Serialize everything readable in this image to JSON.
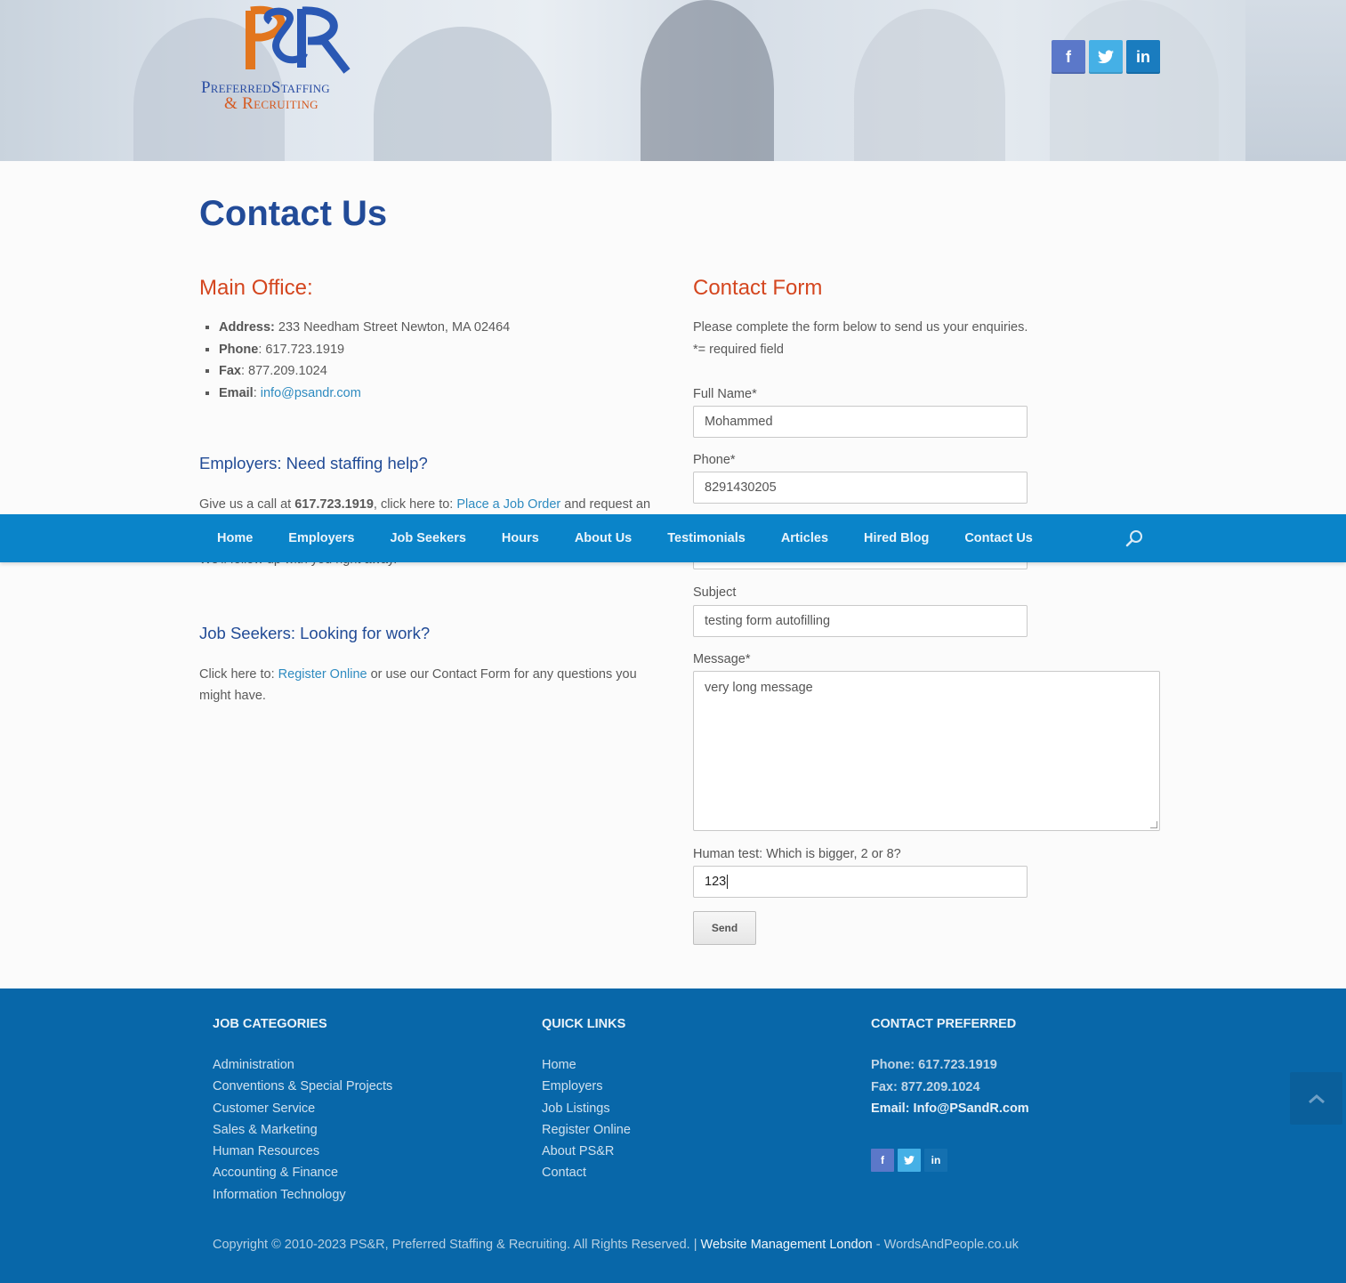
{
  "header": {
    "logo_line1": "PreferredStaffing",
    "logo_line2": "& Recruiting",
    "social": [
      {
        "name": "facebook",
        "glyph": "f",
        "color": "#5b78c9"
      },
      {
        "name": "twitter",
        "glyph": "t",
        "color": "#45b0e6"
      },
      {
        "name": "linkedin",
        "glyph": "in",
        "color": "#1a7cbf"
      }
    ]
  },
  "page": {
    "title": "Contact Us"
  },
  "main_office": {
    "heading": "Main Office:",
    "address_label": "Address:",
    "address_value": " 233 Needham Street Newton, MA 02464",
    "phone_label": "Phone",
    "phone_value": ":  617.723.1919",
    "fax_label": "Fax",
    "fax_value": ": 877.209.1024",
    "email_label": "Email",
    "email_sep": ": ",
    "email_value": "info@psandr.com"
  },
  "employers": {
    "heading": "Employers: Need staffing help?",
    "text_before": "Give us a call at ",
    "phone": "617.723.1919",
    "text_mid": ", click here to: ",
    "link": "Place a Job Order",
    "text_after": " and request an",
    "text_line2": "We'll follow up with you right away."
  },
  "job_seekers": {
    "heading": "Job Seekers: Looking for work?",
    "text_before": "Click here to: ",
    "link": "Register Online",
    "text_after": " or use our Contact Form for any questions you might have."
  },
  "contact_form": {
    "heading": "Contact Form",
    "intro": "Please complete the form below to send us your enquiries.",
    "required_note": "*= required field",
    "full_name_label": "Full Name*",
    "full_name_value": "Mohammed",
    "phone_label": "Phone*",
    "phone_value": "8291430205",
    "subject_label": "Subject",
    "subject_value": "testing form autofilling",
    "message_label": "Message*",
    "message_value": "very long message",
    "human_label": "Human test: Which is bigger, 2 or 8?",
    "human_value": "123",
    "send_label": "Send"
  },
  "nav": {
    "items": [
      "Home",
      "Employers",
      "Job Seekers",
      "Hours",
      "About Us",
      "Testimonials",
      "Articles",
      "Hired Blog",
      "Contact Us"
    ],
    "search_icon": "search-icon"
  },
  "footer": {
    "job_categories": {
      "heading": "JOB CATEGORIES",
      "items": [
        "Administration",
        "Conventions & Special Projects",
        "Customer Service",
        "Sales & Marketing",
        "Human Resources",
        "Accounting & Finance",
        "Information Technology"
      ]
    },
    "quick_links": {
      "heading": "QUICK LINKS",
      "items": [
        "Home",
        "Employers",
        "Job Listings",
        "Register Online",
        "About PS&R",
        "Contact"
      ]
    },
    "contact": {
      "heading": "CONTACT PREFERRED",
      "phone_label": "Phone:",
      "phone_value": " 617.723.1919",
      "fax_label": "Fax:",
      "fax_value": " 877.209.1024",
      "email_label": "Email:",
      "email_value": " Info@PSandR.com"
    },
    "copyright_text": "Copyright © 2010-2023 PS&R, Preferred Staffing & Recruiting. All Rights Reserved. | ",
    "credit_link": "Website Management London",
    "credit_sep": " - ",
    "credit_site": "WordsAndPeople.co.uk"
  }
}
